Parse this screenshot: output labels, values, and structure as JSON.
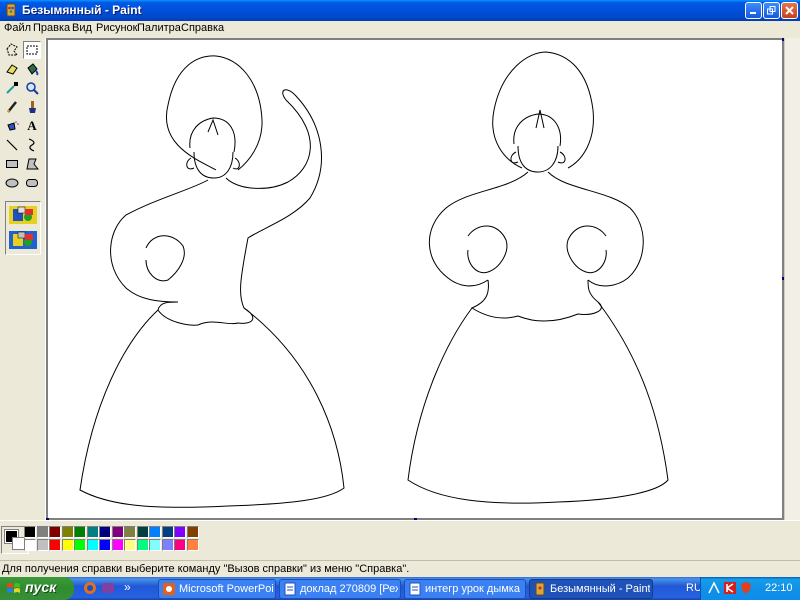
{
  "window": {
    "title": "Безымянный - Paint"
  },
  "menu": [
    "Файл",
    "Правка",
    "Вид",
    "Рисунок",
    "Палитра",
    "Справка"
  ],
  "tools": [
    {
      "name": "free-select-icon"
    },
    {
      "name": "rect-select-icon"
    },
    {
      "name": "eraser-icon"
    },
    {
      "name": "fill-icon"
    },
    {
      "name": "color-picker-icon"
    },
    {
      "name": "magnifier-icon"
    },
    {
      "name": "pencil-icon"
    },
    {
      "name": "brush-icon"
    },
    {
      "name": "airbrush-icon"
    },
    {
      "name": "text-icon",
      "glyph": "A"
    },
    {
      "name": "line-icon"
    },
    {
      "name": "curve-icon"
    },
    {
      "name": "rectangle-icon"
    },
    {
      "name": "polygon-icon"
    },
    {
      "name": "ellipse-icon"
    },
    {
      "name": "rounded-rect-icon"
    }
  ],
  "palette": {
    "foreground": "#000000",
    "background": "#ffffff",
    "colors": [
      "#000000",
      "#808080",
      "#800000",
      "#808000",
      "#008000",
      "#008080",
      "#000080",
      "#800080",
      "#808040",
      "#004040",
      "#0080ff",
      "#004080",
      "#8000ff",
      "#804000",
      "#ffffff",
      "#c0c0c0",
      "#ff0000",
      "#ffff00",
      "#00ff00",
      "#00ffff",
      "#0000ff",
      "#ff00ff",
      "#ffff80",
      "#00ff80",
      "#80ffff",
      "#8080ff",
      "#ff0080",
      "#ff8040"
    ]
  },
  "status": {
    "text": "Для получения справки выберите команду \"Вызов справки\" из меню \"Справка\"."
  },
  "taskbar": {
    "start_label": "пуск",
    "chevron": "»",
    "tasks": [
      {
        "label": "Microsoft PowerPoint ...",
        "active": false
      },
      {
        "label": "доклад 270809 [Реж...",
        "active": false
      },
      {
        "label": "интегр урок дымка ...",
        "active": false
      },
      {
        "label": "Безымянный - Paint",
        "active": true
      }
    ],
    "language": "RU",
    "clock": "22:10"
  }
}
